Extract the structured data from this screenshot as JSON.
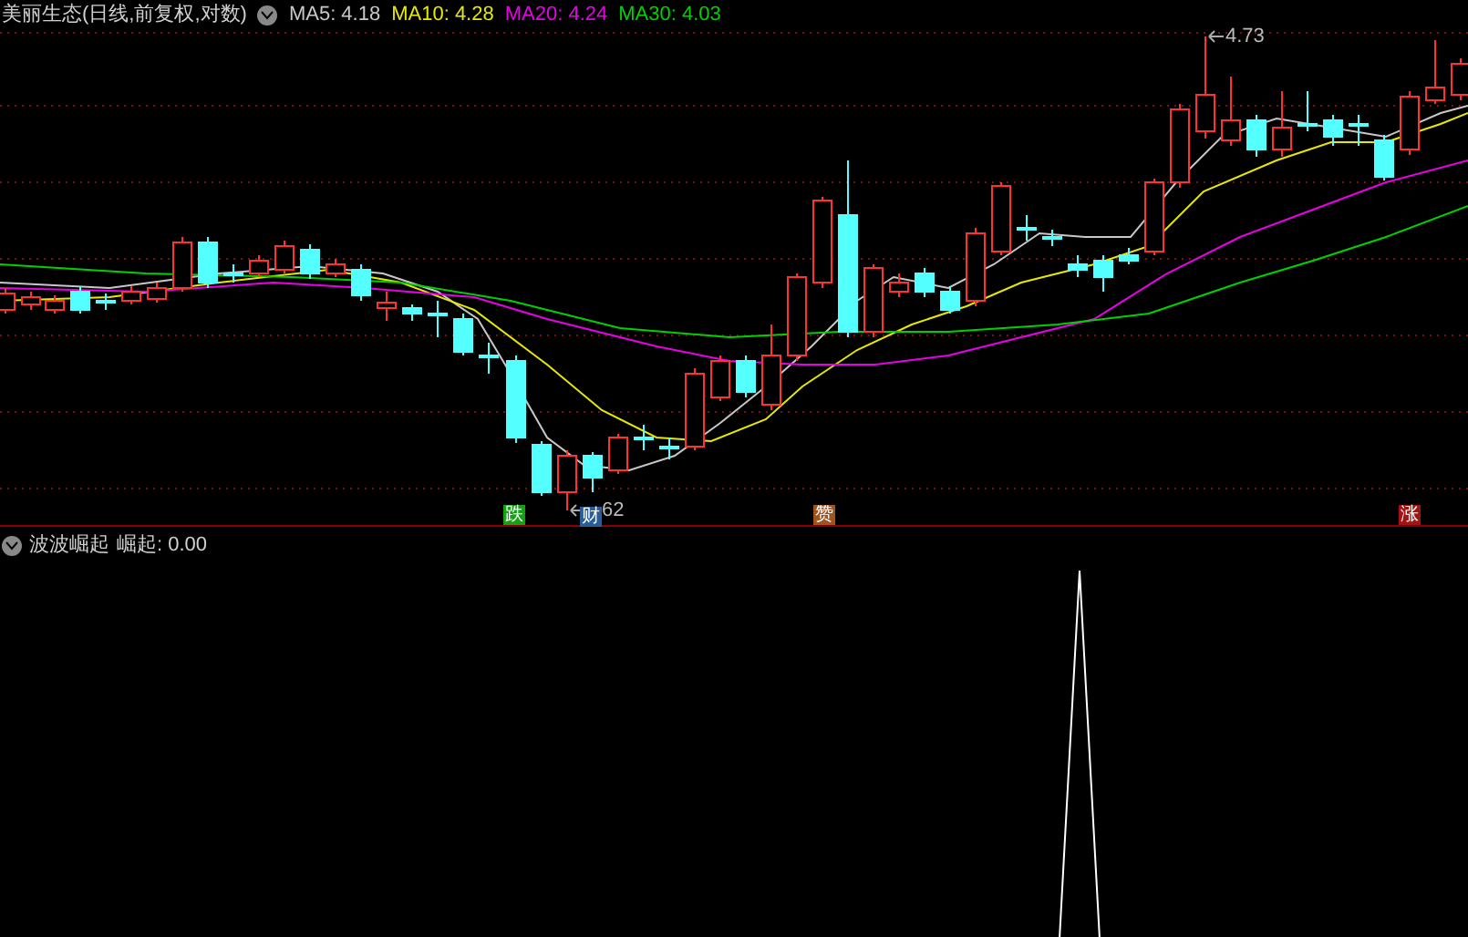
{
  "main_pane": {
    "title": "美丽生态(日线,前复权,对数)",
    "indicators": [
      {
        "label": "MA5: 4.18",
        "color": "#c8c8c8"
      },
      {
        "label": "MA10: 4.28",
        "color": "#e8e800"
      },
      {
        "label": "MA20: 4.24",
        "color": "#e800e8"
      },
      {
        "label": "MA30: 4.03",
        "color": "#00d000"
      }
    ],
    "price_labels": [
      "4.73",
      "62"
    ],
    "signal_badges": [
      {
        "text": "跌",
        "color": "#16a016"
      },
      {
        "text": "财",
        "color": "#2a5c9a"
      },
      {
        "text": "赞",
        "color": "#a0541e"
      },
      {
        "text": "涨",
        "color": "#a01414"
      }
    ]
  },
  "sub_pane": {
    "title": "波波崛起",
    "reading": "崛起: 0.00"
  }
}
